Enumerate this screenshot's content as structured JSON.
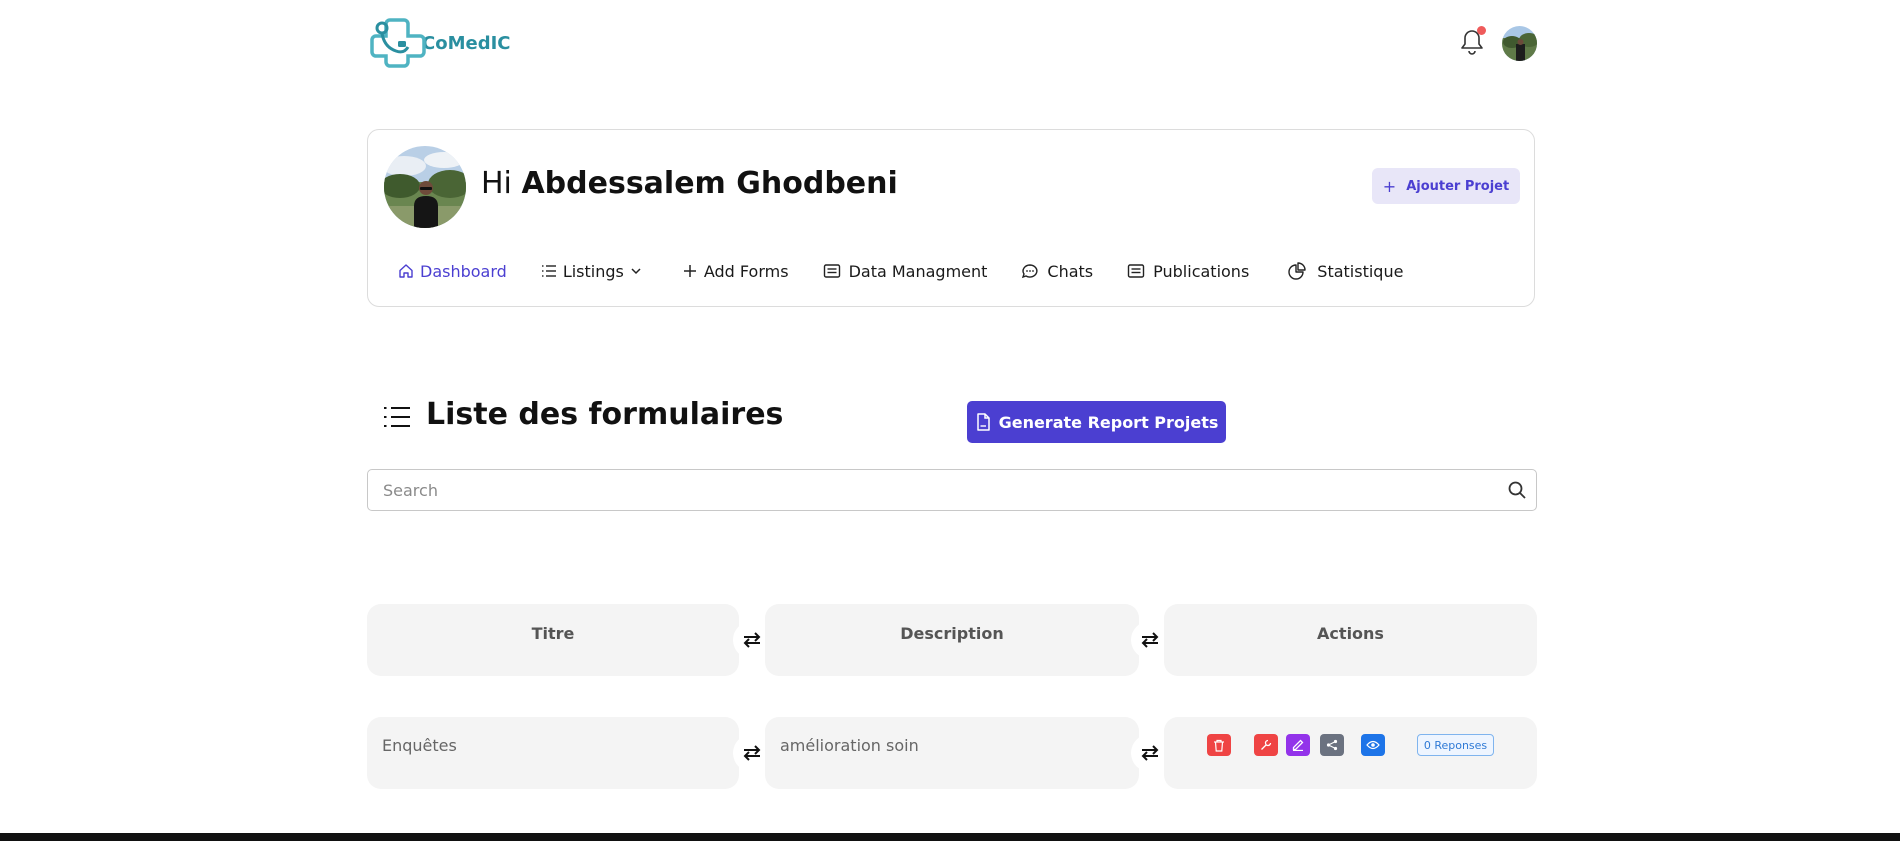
{
  "header": {
    "logo_text": "CoMedIC",
    "brand_color": "#2a8fa0",
    "notification_dot_color": "#ef5b5b"
  },
  "profile": {
    "greeting": "Hi",
    "user_name": "Abdessalem Ghodbeni",
    "add_project_label": "Ajouter Projet"
  },
  "nav": {
    "items": [
      {
        "label": "Dashboard",
        "icon": "home-icon",
        "active": true
      },
      {
        "label": "Listings",
        "icon": "list-icon"
      },
      {
        "label": "Add Forms",
        "icon": "plus-icon"
      },
      {
        "label": "Data Managment",
        "icon": "document-icon"
      },
      {
        "label": "Chats",
        "icon": "chat-icon"
      },
      {
        "label": "Publications",
        "icon": "document-icon"
      },
      {
        "label": "Statistique",
        "icon": "pie-chart-icon"
      }
    ]
  },
  "forms": {
    "title": "Liste des formulaires",
    "report_button_label": "Generate Report Projets",
    "search_placeholder": "Search",
    "columns": [
      "Titre",
      "Description",
      "Actions"
    ],
    "rows": [
      {
        "titre": "Enquêtes",
        "description": "amélioration soin",
        "responses_label": "0 Reponses"
      }
    ]
  },
  "colors": {
    "accent": "#4b3fd1",
    "delete": "#ef4444",
    "tool": "#ef4444",
    "edit": "#9333ea",
    "share": "#6b7280",
    "view": "#1d74e8"
  }
}
